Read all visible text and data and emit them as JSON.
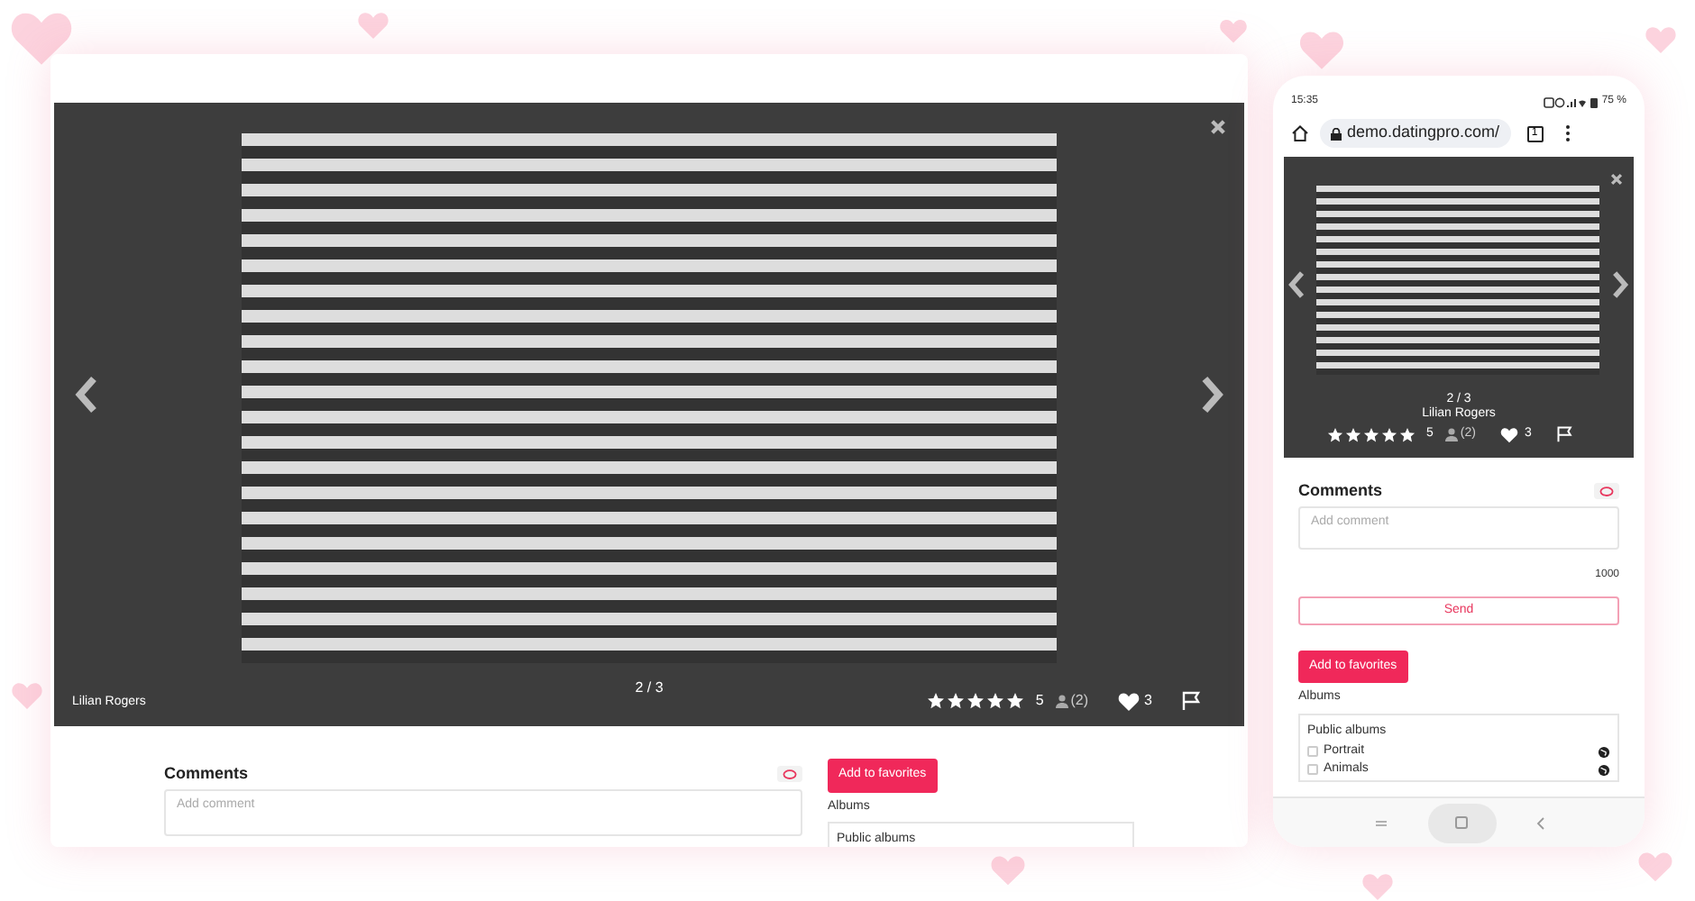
{
  "desktop": {
    "viewer": {
      "counter": "2 / 3",
      "owner": "Lilian Rogers",
      "stars": 5,
      "rating": "5",
      "votes": "(2)",
      "likes": "3"
    },
    "comments": {
      "title": "Comments",
      "placeholder": "Add comment"
    },
    "favorites_button": "Add to favorites",
    "albums_label": "Albums",
    "albums_title": "Public albums"
  },
  "phone": {
    "status_bar": {
      "time": "15:35",
      "battery": "75 %"
    },
    "address_bar": {
      "url": "demo.datingpro.com/",
      "tab_count": "1"
    },
    "viewer": {
      "counter": "2 / 3",
      "owner": "Lilian Rogers",
      "stars": 5,
      "rating": "5",
      "votes": "(2)",
      "likes": "3"
    },
    "comments": {
      "title": "Comments",
      "placeholder": "Add comment",
      "char_limit": "1000",
      "send_button": "Send"
    },
    "favorites_button": "Add to favorites",
    "albums_label": "Albums",
    "albums_title": "Public albums",
    "albums": [
      {
        "name": "Portrait",
        "checked": false
      },
      {
        "name": "Animals",
        "checked": false
      }
    ]
  }
}
